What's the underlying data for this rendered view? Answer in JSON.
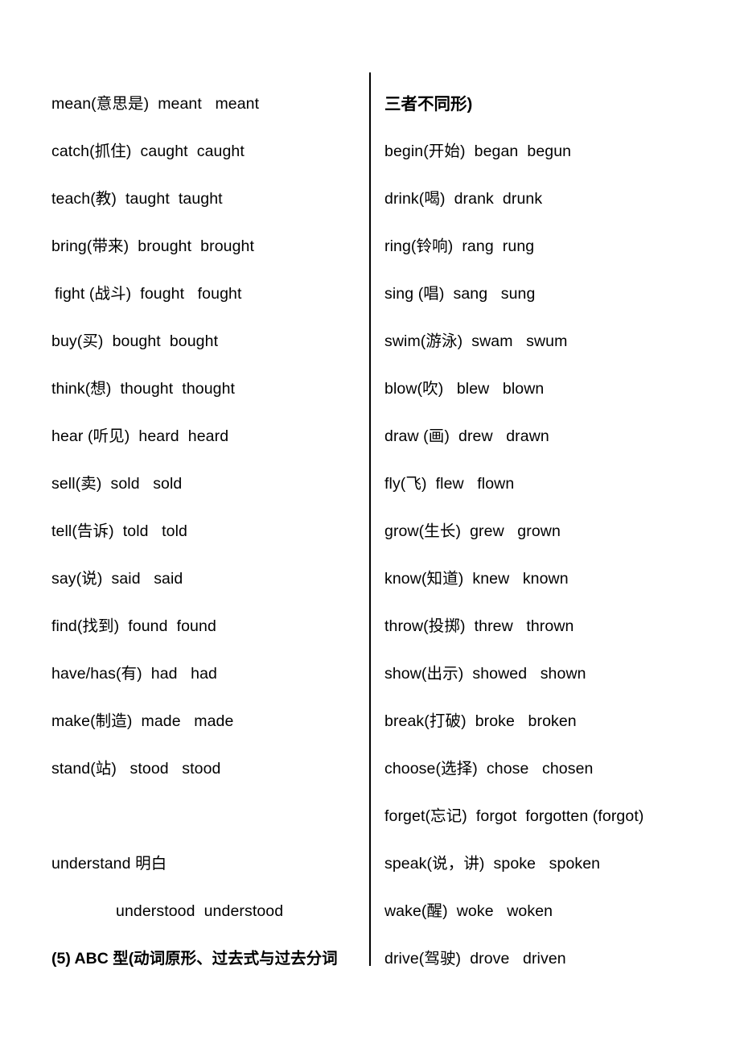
{
  "document": {
    "kind": "study-handout",
    "topic": "English irregular verbs list (Chinese annotated)",
    "text_color": "#000000",
    "background_color": "#ffffff",
    "divider_color": "#000000"
  },
  "left_column": {
    "rows": [
      {
        "text": "mean(意思是)  meant   meant",
        "style": "normal"
      },
      {
        "text": "catch(抓住)  caught  caught",
        "style": "normal"
      },
      {
        "text": "teach(教)  taught  taught",
        "style": "normal"
      },
      {
        "text": "bring(带来)  brought  brought",
        "style": "normal"
      },
      {
        "text": "fight (战斗)  fought   fought",
        "style": "indent-small"
      },
      {
        "text": "buy(买)  bought  bought",
        "style": "normal"
      },
      {
        "text": "think(想)  thought  thought",
        "style": "normal"
      },
      {
        "text": "hear (听见)  heard  heard",
        "style": "normal"
      },
      {
        "text": "sell(卖)  sold   sold",
        "style": "normal"
      },
      {
        "text": "tell(告诉)  told   told",
        "style": "normal"
      },
      {
        "text": "say(说)  said   said",
        "style": "normal"
      },
      {
        "text": "find(找到)  found  found",
        "style": "normal"
      },
      {
        "text": "have/has(有)  had   had",
        "style": "normal"
      },
      {
        "text": "make(制造)  made   made",
        "style": "normal"
      },
      {
        "text": "stand(站)   stood   stood",
        "style": "normal"
      },
      {
        "text": "",
        "style": "blank"
      },
      {
        "text": "understand 明白",
        "style": "normal"
      },
      {
        "text": "understood  understood",
        "style": "indent-large"
      }
    ],
    "section_heading": "(5) ABC 型(动词原形、过去式与过去分词"
  },
  "right_column": {
    "heading": "三者不同形)",
    "rows": [
      {
        "text": "begin(开始)  began  begun",
        "style": "normal"
      },
      {
        "text": "drink(喝)  drank  drunk",
        "style": "normal"
      },
      {
        "text": "ring(铃响)  rang  rung",
        "style": "normal"
      },
      {
        "text": "sing (唱)  sang   sung",
        "style": "normal"
      },
      {
        "text": "swim(游泳)  swam   swum",
        "style": "normal"
      },
      {
        "text": "blow(吹)   blew   blown",
        "style": "normal"
      },
      {
        "text": "draw (画)  drew   drawn",
        "style": "normal"
      },
      {
        "text": "fly(飞)  flew   flown",
        "style": "normal"
      },
      {
        "text": "grow(生长)  grew   grown",
        "style": "normal"
      },
      {
        "text": "know(知道)  knew   known",
        "style": "normal"
      },
      {
        "text": "throw(投掷)  threw   thrown",
        "style": "normal"
      },
      {
        "text": "show(出示)  showed   shown",
        "style": "normal"
      },
      {
        "text": "break(打破)  broke   broken",
        "style": "normal"
      },
      {
        "text": "choose(选择)  chose   chosen",
        "style": "normal"
      },
      {
        "text": "forget(忘记)  forgot  forgotten (forgot)",
        "style": "normal"
      },
      {
        "text": "speak(说，讲)  spoke   spoken",
        "style": "normal"
      },
      {
        "text": "wake(醒)  woke   woken",
        "style": "normal"
      },
      {
        "text": "drive(驾驶)  drove   driven",
        "style": "normal"
      }
    ]
  }
}
